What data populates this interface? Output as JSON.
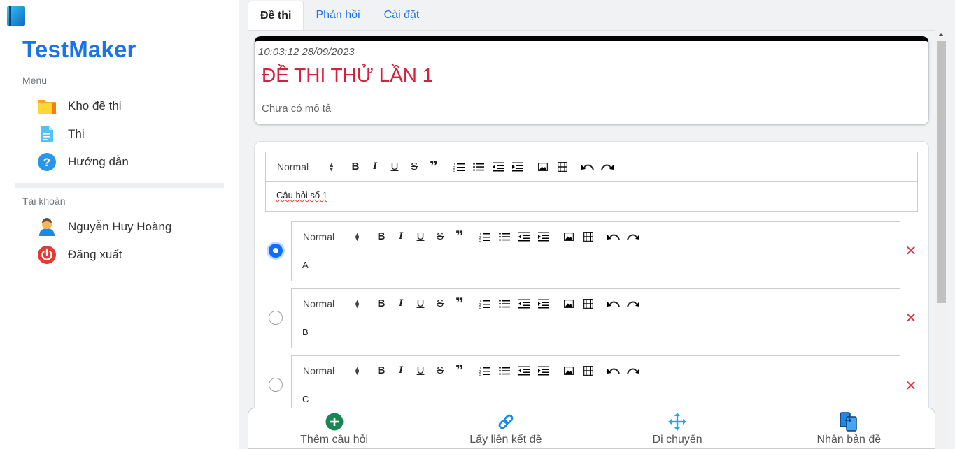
{
  "app": {
    "brand": "TestMaker"
  },
  "sidebar": {
    "menu_label": "Menu",
    "menu_items": [
      {
        "label": "Kho đề thi",
        "icon": "folder-icon"
      },
      {
        "label": "Thi",
        "icon": "document-icon"
      },
      {
        "label": "Hướng dẫn",
        "icon": "help-icon"
      }
    ],
    "account_label": "Tài khoản",
    "account_items": [
      {
        "label": "Nguyễn Huy Hoàng",
        "icon": "user-icon"
      },
      {
        "label": "Đăng xuất",
        "icon": "power-icon"
      }
    ]
  },
  "tabs": [
    {
      "label": "Đề thi",
      "active": true
    },
    {
      "label": "Phản hồi",
      "active": false
    },
    {
      "label": "Cài đặt",
      "active": false
    }
  ],
  "exam": {
    "timestamp": "10:03:12 28/09/2023",
    "title": "ĐỀ THI THỬ LẦN 1",
    "description": "Chưa có mô tả"
  },
  "editor": {
    "format_select": "Normal"
  },
  "question": {
    "text": "Câu hỏi số 1",
    "answers": [
      {
        "text": "A",
        "selected": true
      },
      {
        "text": "B",
        "selected": false
      },
      {
        "text": "C",
        "selected": false
      }
    ]
  },
  "actions": [
    {
      "label": "Thêm câu hỏi",
      "icon": "plus-circle-icon"
    },
    {
      "label": "Lấy liên kết đề",
      "icon": "link-icon"
    },
    {
      "label": "Di chuyển",
      "icon": "move-icon"
    },
    {
      "label": "Nhân bản đề",
      "icon": "duplicate-icon"
    }
  ],
  "colors": {
    "brand": "#1a73e8",
    "title_red": "#d4213d",
    "delete_red": "#dc3545",
    "radio_blue": "#0d6efd"
  }
}
